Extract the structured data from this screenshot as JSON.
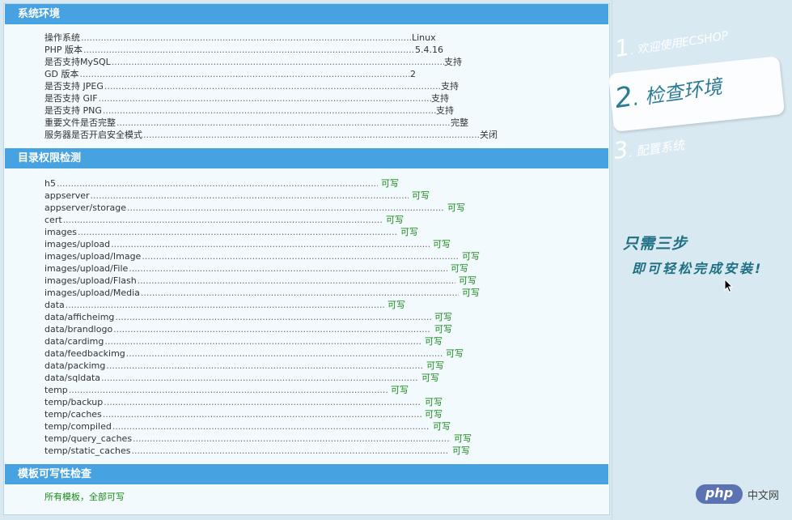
{
  "env": {
    "title": "系统环境",
    "rows": [
      {
        "label": "操作系统",
        "value": "Linux",
        "end": 454
      },
      {
        "label": "PHP 版本",
        "value": "5.4.16",
        "end": 458
      },
      {
        "label": "是否支持MySQL",
        "value": "支持",
        "end": 494
      },
      {
        "label": "GD 版本",
        "value": "2",
        "end": 452
      },
      {
        "label": "是否支持 JPEG",
        "value": "支持",
        "end": 490
      },
      {
        "label": "是否支持 GIF",
        "value": "支持",
        "end": 478
      },
      {
        "label": "是否支持 PNG",
        "value": "支持",
        "end": 484
      },
      {
        "label": "重要文件是否完整",
        "value": "完整",
        "end": 502
      },
      {
        "label": "服务器是否开启安全模式",
        "value": "关闭",
        "end": 538
      }
    ]
  },
  "perm": {
    "title": "目录权限检测",
    "ok_text": "可写",
    "rows": [
      {
        "label": "h5",
        "end": 412
      },
      {
        "label": "appserver",
        "end": 450
      },
      {
        "label": "appserver/storage",
        "end": 494
      },
      {
        "label": "cert",
        "end": 418
      },
      {
        "label": "images",
        "end": 436
      },
      {
        "label": "images/upload",
        "end": 476
      },
      {
        "label": "images/upload/Image",
        "end": 512
      },
      {
        "label": "images/upload/File",
        "end": 498
      },
      {
        "label": "images/upload/Flash",
        "end": 508
      },
      {
        "label": "images/upload/Media",
        "end": 512
      },
      {
        "label": "data",
        "end": 420
      },
      {
        "label": "data/afficheimg",
        "end": 478
      },
      {
        "label": "data/brandlogo",
        "end": 478
      },
      {
        "label": "data/cardimg",
        "end": 466
      },
      {
        "label": "data/feedbackimg",
        "end": 492
      },
      {
        "label": "data/packimg",
        "end": 468
      },
      {
        "label": "data/sqldata",
        "end": 462
      },
      {
        "label": "temp",
        "end": 424
      },
      {
        "label": "temp/backup",
        "end": 466
      },
      {
        "label": "temp/caches",
        "end": 466
      },
      {
        "label": "temp/compiled",
        "end": 476
      },
      {
        "label": "temp/query_caches",
        "end": 502
      },
      {
        "label": "temp/static_caches",
        "end": 500
      }
    ]
  },
  "tpl": {
    "title": "模板可写性检查",
    "result": "所有模板，全部可写"
  },
  "steps": {
    "step1_num": "1",
    "step1_text": ". 欢迎使用ECSHOP",
    "step2_num": "2",
    "step2_text": ". 检查环境",
    "step3_num": "3",
    "step3_text": ". 配置系统"
  },
  "slogan": {
    "line1": "只需三步",
    "line2": "即可轻松完成安装!"
  },
  "watermark": {
    "logo": "php",
    "text": "中文网"
  },
  "colors": {
    "header_bg": "#46a2e0",
    "ok": "#1a8a1a",
    "side_bg": "#d9e9f1",
    "step_active": "#2d7a94"
  }
}
